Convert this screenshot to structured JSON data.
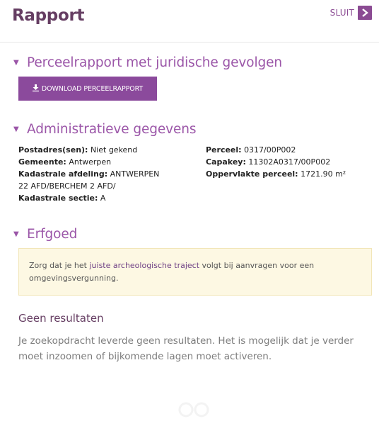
{
  "header": {
    "title": "Rapport",
    "close_label": "SLUIT",
    "close_icon": "chevron-right-icon"
  },
  "sections": {
    "perceel": {
      "title": "Perceelrapport met juridische gevolgen",
      "download_label": "DOWNLOAD PERCEELRAPPORT",
      "download_icon": "download-icon"
    },
    "admin": {
      "title": "Administratieve gegevens",
      "left": [
        {
          "label": "Postadres(sen):",
          "value": "Niet gekend"
        },
        {
          "label": "Gemeente:",
          "value": "Antwerpen"
        },
        {
          "label": "Kadastrale afdeling:",
          "value": "ANTWERPEN 22 AFD/BERCHEM 2 AFD/"
        },
        {
          "label": "Kadastrale sectie:",
          "value": "A"
        }
      ],
      "right": [
        {
          "label": "Perceel:",
          "value": "0317/00P002"
        },
        {
          "label": "Capakey:",
          "value": "11302A0317/00P002"
        },
        {
          "label": "Oppervlakte perceel:",
          "value": "1721.90 m²"
        }
      ]
    },
    "erfgoed": {
      "title": "Erfgoed",
      "alert_pre": "Zorg dat je het ",
      "alert_link": "juiste archeologische traject",
      "alert_post": " volgt bij aanvragen voor een omgevingsvergunning."
    }
  },
  "no_results": {
    "title": "Geen resultaten",
    "text": "Je zoekopdracht leverde geen resultaten. Het is mogelijk dat je verder moet inzoomen of bijkomende lagen moet activeren."
  },
  "colors": {
    "brand": "#653d62",
    "accent": "#9b56a8",
    "button": "#8b4a9c",
    "alert_bg": "#fdf8e3"
  }
}
